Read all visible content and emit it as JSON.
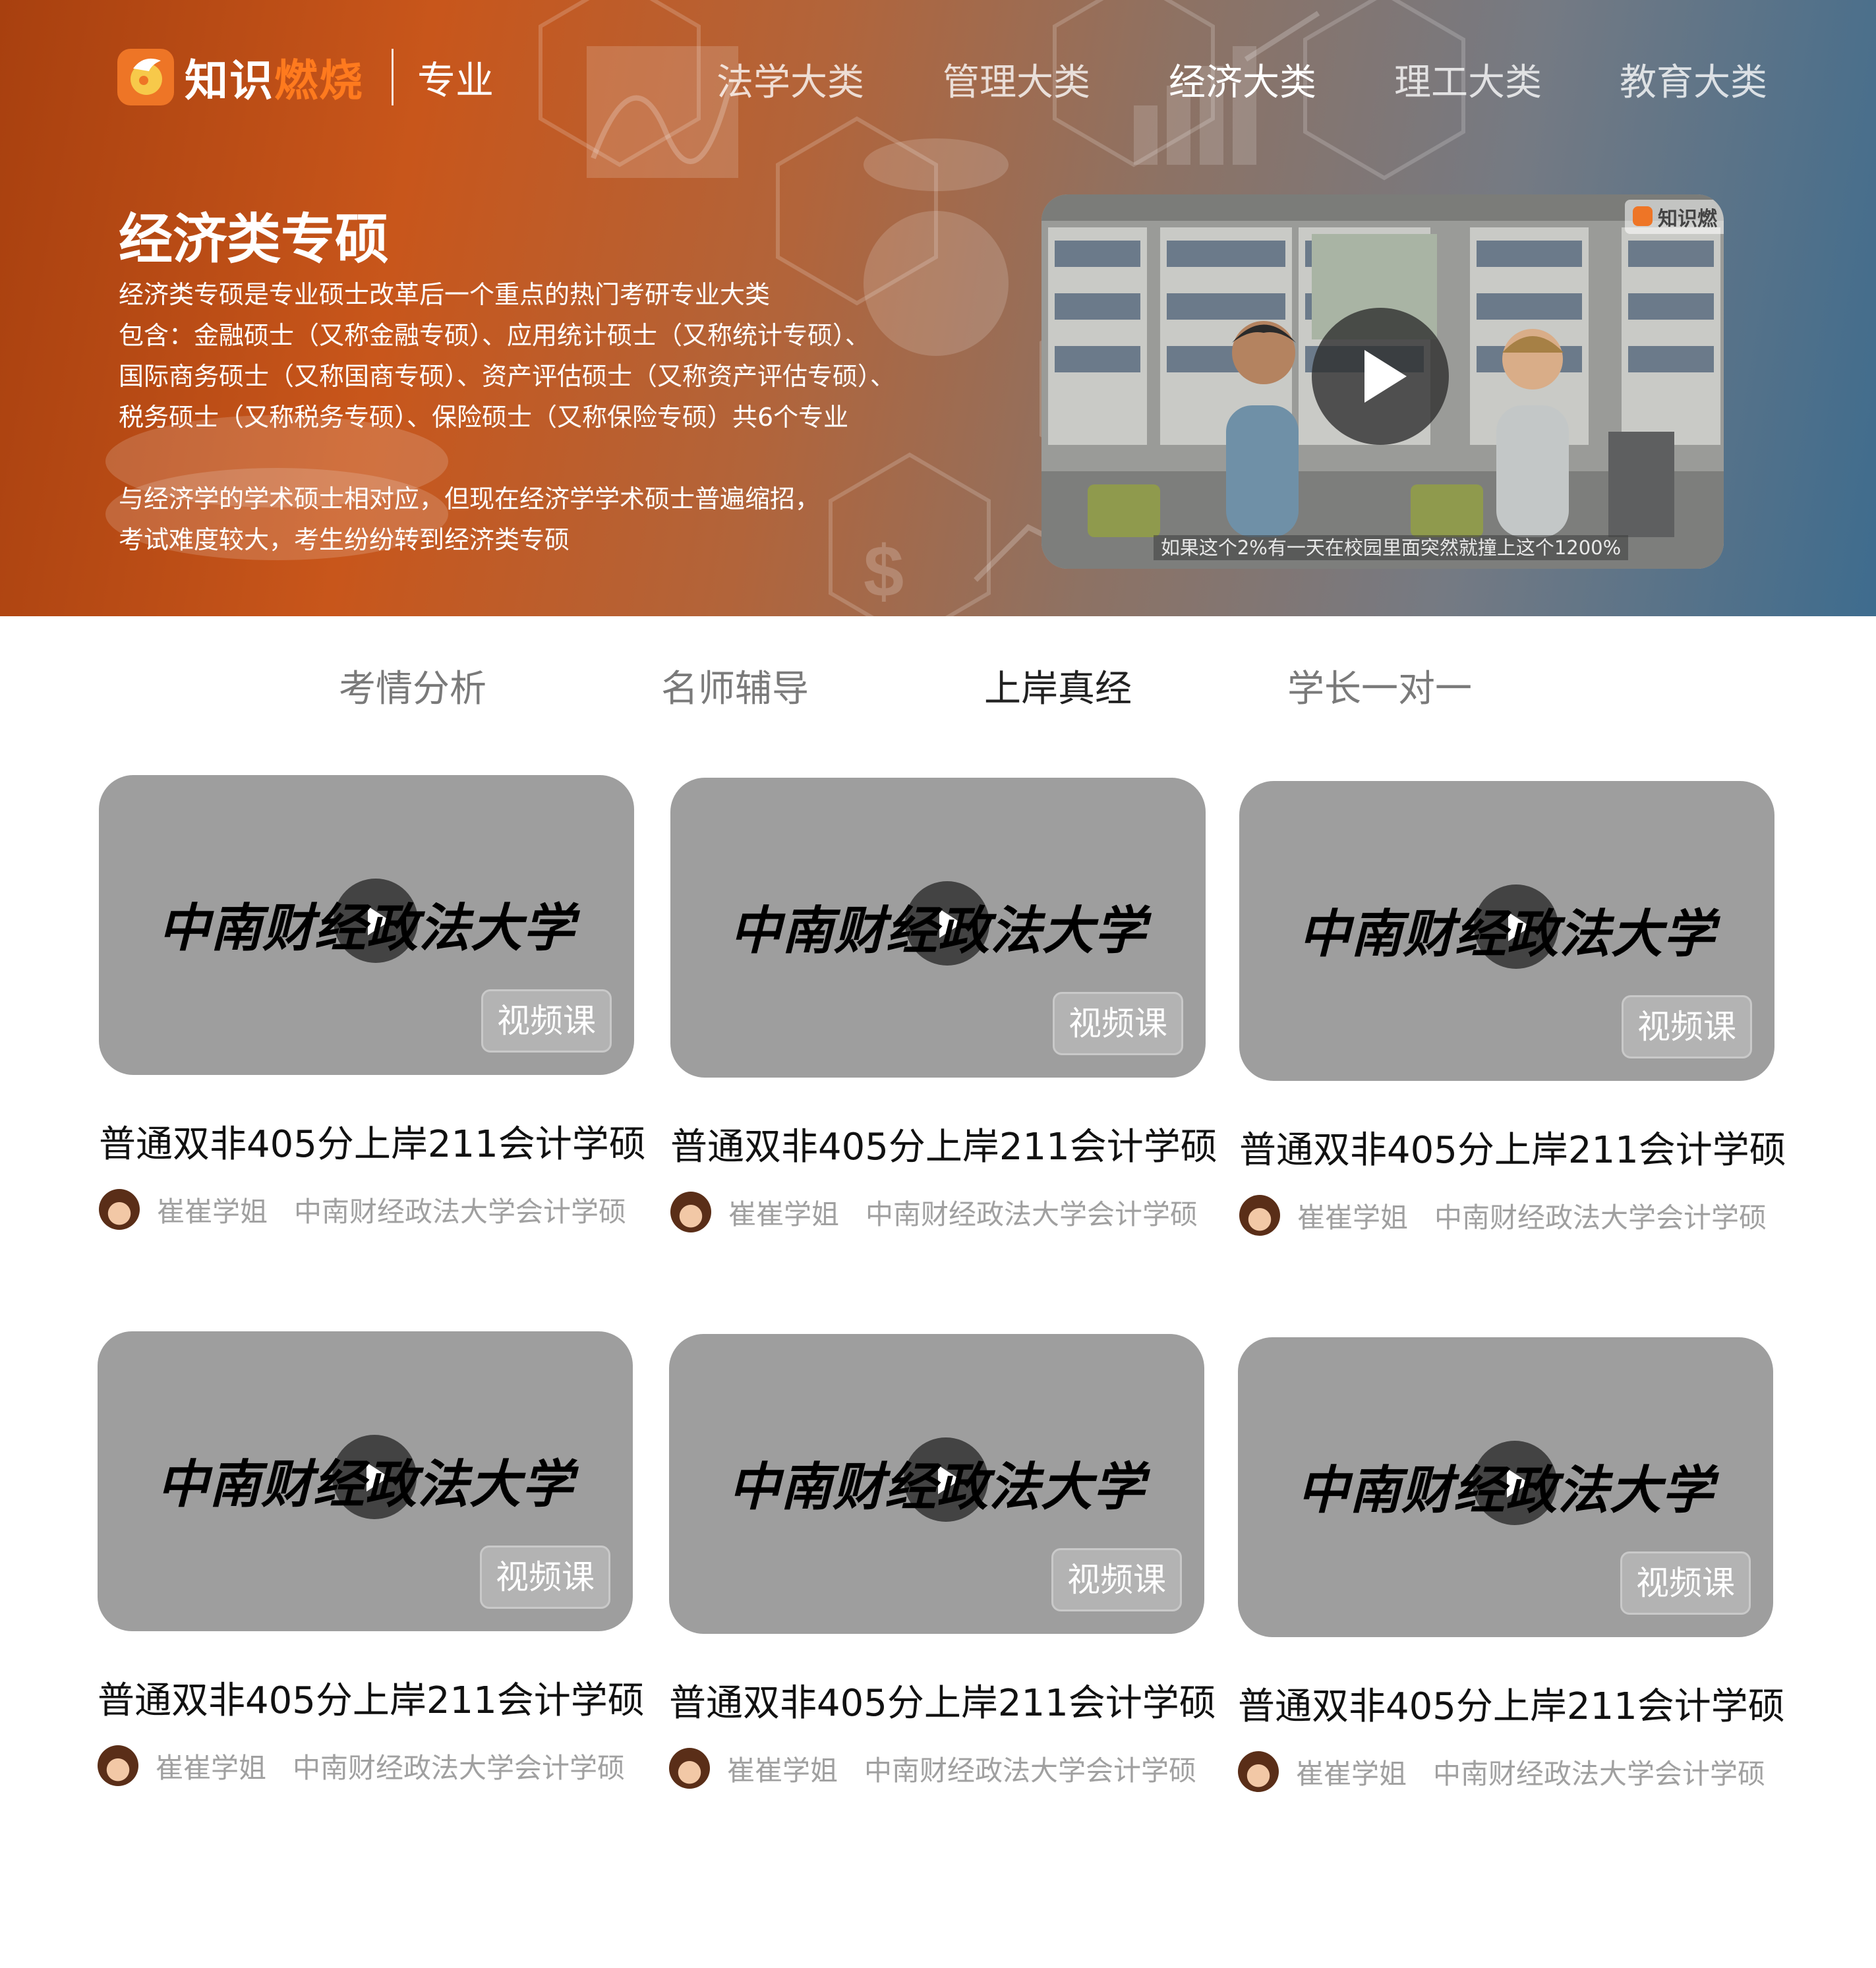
{
  "brand": {
    "name_part1": "知识",
    "name_part2": "燃烧",
    "section": "专业",
    "accent_color": "#ee7526"
  },
  "nav": {
    "items": [
      {
        "label": "法学大类",
        "active": false
      },
      {
        "label": "管理大类",
        "active": false
      },
      {
        "label": "经济大类",
        "active": true
      },
      {
        "label": "理工大类",
        "active": false
      },
      {
        "label": "教育大类",
        "active": false
      }
    ]
  },
  "hero": {
    "title": "经济类专硕",
    "desc_lines": [
      "经济类专硕是专业硕士改革后一个重点的热门考研专业大类",
      "包含：金融硕士（又称金融专硕）、应用统计硕士（又称统计专硕）、",
      "国际商务硕士（又称国商专硕）、资产评估硕士（又称资产评估专硕）、",
      "税务硕士（又称税务专硕）、保险硕士（又称保险专硕）共6个专业",
      "与经济学的学术硕士相对应，但现在经济学学术硕士普遍缩招，",
      "考试难度较大，考生纷纷转到经济类专硕"
    ],
    "video": {
      "watermark": "知识燃",
      "subtitle": "如果这个2%有一天在校园里面突然就撞上这个1200%",
      "play_icon": "play-icon"
    }
  },
  "tabs": [
    {
      "label": "考情分析",
      "active": false
    },
    {
      "label": "名师辅导",
      "active": false
    },
    {
      "label": "上岸真经",
      "active": true
    },
    {
      "label": "学长一对一",
      "active": false
    }
  ],
  "cards": [
    {
      "school": "中南财经政法大学",
      "badge": "视频课",
      "title": "普通双非405分上岸211会计学硕",
      "author": "崔崔学姐",
      "major": "中南财经政法大学会计学硕"
    },
    {
      "school": "中南财经政法大学",
      "badge": "视频课",
      "title": "普通双非405分上岸211会计学硕",
      "author": "崔崔学姐",
      "major": "中南财经政法大学会计学硕"
    },
    {
      "school": "中南财经政法大学",
      "badge": "视频课",
      "title": "普通双非405分上岸211会计学硕",
      "author": "崔崔学姐",
      "major": "中南财经政法大学会计学硕"
    },
    {
      "school": "中南财经政法大学",
      "badge": "视频课",
      "title": "普通双非405分上岸211会计学硕",
      "author": "崔崔学姐",
      "major": "中南财经政法大学会计学硕"
    },
    {
      "school": "中南财经政法大学",
      "badge": "视频课",
      "title": "普通双非405分上岸211会计学硕",
      "author": "崔崔学姐",
      "major": "中南财经政法大学会计学硕"
    },
    {
      "school": "中南财经政法大学",
      "badge": "视频课",
      "title": "普通双非405分上岸211会计学硕",
      "author": "崔崔学姐",
      "major": "中南财经政法大学会计学硕"
    }
  ]
}
